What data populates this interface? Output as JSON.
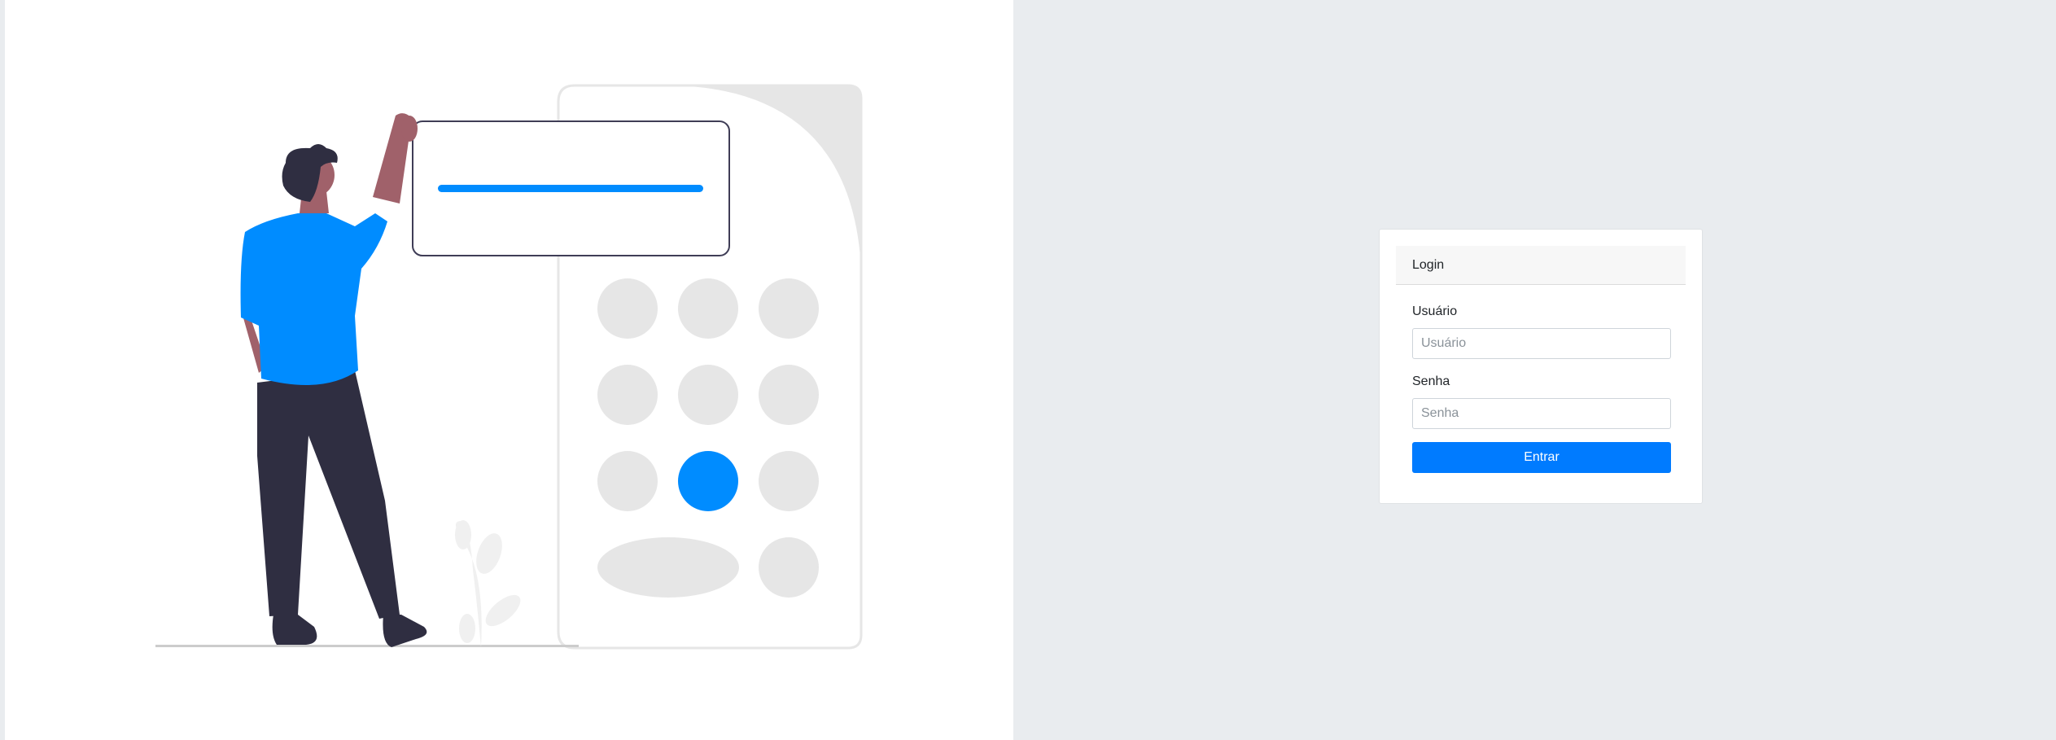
{
  "colors": {
    "accent": "#008cff",
    "button": "#007bff",
    "background": "#e9ecef",
    "illustration_gray": "#e6e6e6",
    "figure_dark": "#2f2e41",
    "skin": "#a0616a"
  },
  "login_card": {
    "header": "Login",
    "username": {
      "label": "Usuário",
      "placeholder": "Usuário",
      "value": ""
    },
    "password": {
      "label": "Senha",
      "placeholder": "Senha",
      "value": ""
    },
    "submit_label": "Entrar"
  },
  "illustration": {
    "icon": "person-with-keypad-illustration"
  }
}
